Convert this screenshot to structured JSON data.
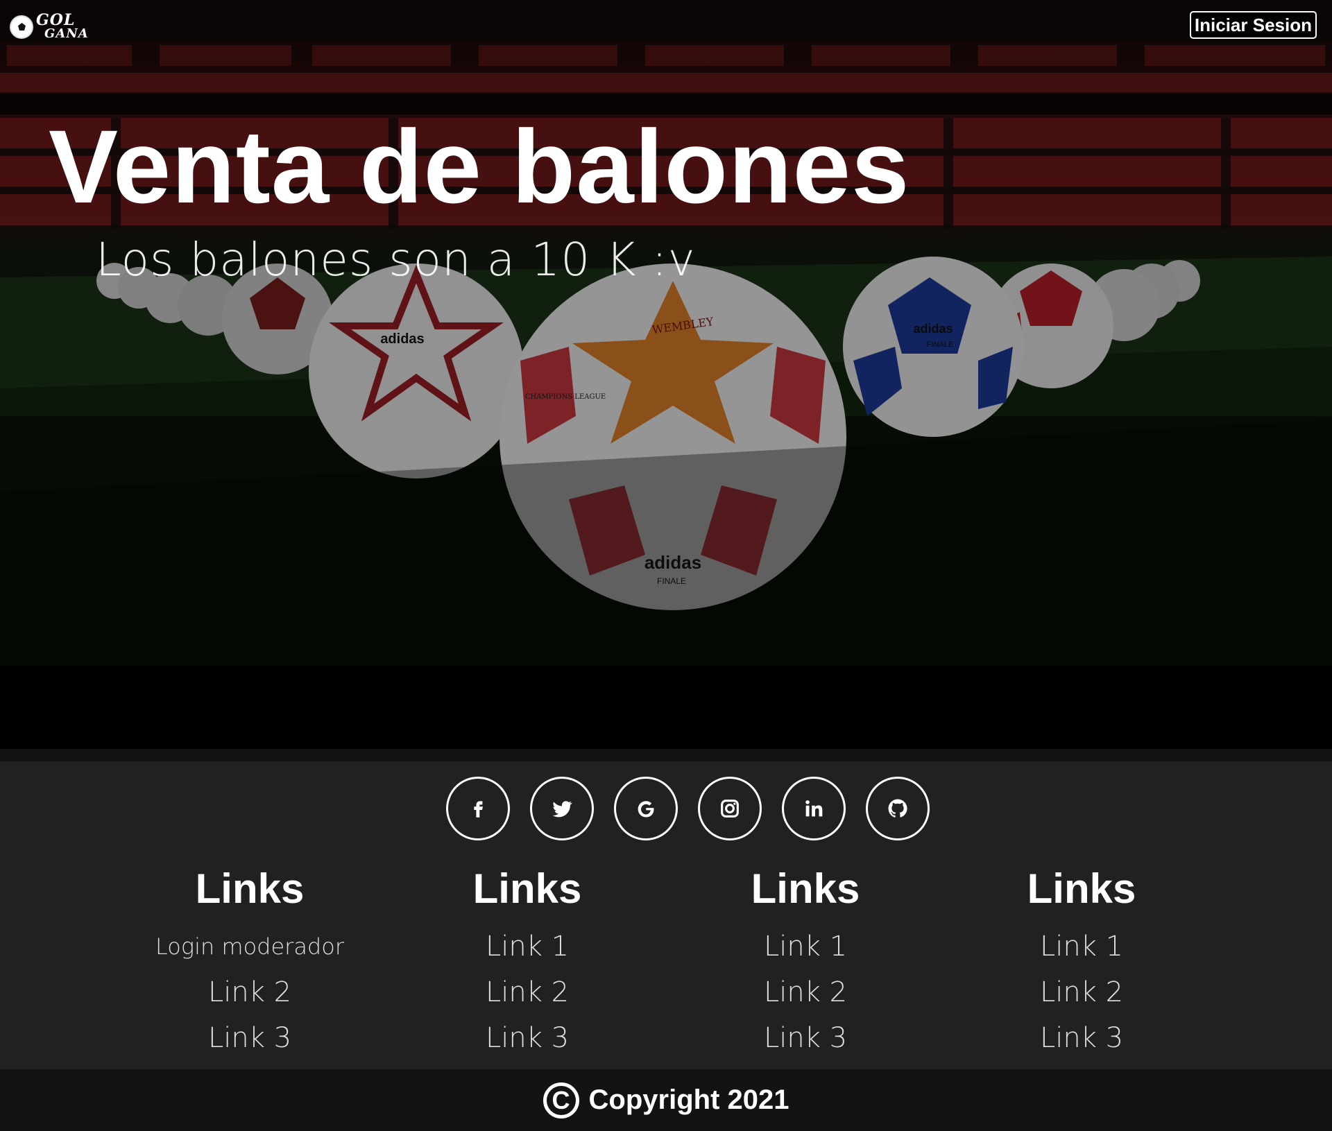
{
  "header": {
    "logo_line1": "GOL",
    "logo_line2": "GANA",
    "login_label": "Iniciar Sesion"
  },
  "hero": {
    "title": "Venta de balones",
    "subtitle": "Los balones son a 10 K :v",
    "ball_print_1": "WEMBLEY",
    "ball_print_2": "adidas",
    "ball_print_3": "FINALE",
    "ball_print_4": "CHAMPIONS LEAGUE"
  },
  "footer": {
    "socials": [
      {
        "icon": "facebook-icon"
      },
      {
        "icon": "twitter-icon"
      },
      {
        "icon": "google-icon"
      },
      {
        "icon": "instagram-icon"
      },
      {
        "icon": "linkedin-icon"
      },
      {
        "icon": "github-icon"
      }
    ],
    "columns": [
      {
        "title": "Links",
        "links": [
          "Login moderador",
          "Link 2",
          "Link 3"
        ]
      },
      {
        "title": "Links",
        "links": [
          "Link 1",
          "Link 2",
          "Link 3"
        ]
      },
      {
        "title": "Links",
        "links": [
          "Link 1",
          "Link 2",
          "Link 3"
        ]
      },
      {
        "title": "Links",
        "links": [
          "Link 1",
          "Link 2",
          "Link 3"
        ]
      }
    ],
    "copyright_symbol": "C",
    "copyright_text": "Copyright 2021"
  }
}
